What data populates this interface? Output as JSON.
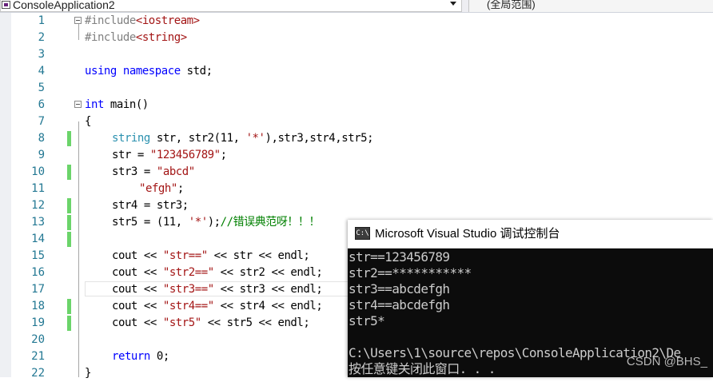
{
  "toolbar": {
    "project_name": "ConsoleApplication2",
    "scope_label": "(全局范围)"
  },
  "editor": {
    "line_numbers": [
      "1",
      "2",
      "3",
      "4",
      "5",
      "6",
      "7",
      "8",
      "9",
      "10",
      "11",
      "12",
      "13",
      "14",
      "15",
      "16",
      "17",
      "18",
      "19",
      "20",
      "21",
      "22"
    ],
    "code": {
      "l1_pp": "#include",
      "l1_hdr": "<iostream>",
      "l2_pp": "#include",
      "l2_hdr": "<string>",
      "l4_kw1": "using",
      "l4_kw2": "namespace",
      "l4_rest": " std;",
      "l6_kw": "int",
      "l6_rest": " main()",
      "l7": "{",
      "l8_ty": "string",
      "l8_a": " str, str2(11, ",
      "l8_s": "'*'",
      "l8_b": "),str3,str4,str5;",
      "l9_a": "str = ",
      "l9_s": "\"123456789\"",
      "l9_b": ";",
      "l10_a": "str3 = ",
      "l10_s": "\"abcd\"",
      "l11_s": "\"efgh\"",
      "l11_b": ";",
      "l12": "str4 = str3;",
      "l13_a": "str5 = (11, ",
      "l13_s": "'*'",
      "l13_b": ");",
      "l13_c": "//错误典范呀！！！",
      "l15_a": "cout << ",
      "l15_s": "\"str==\"",
      "l15_b": " << str << endl;",
      "l16_a": "cout << ",
      "l16_s": "\"str2==\"",
      "l16_b": " << str2 << endl;",
      "l17_a": "cout << ",
      "l17_s": "\"str3==\"",
      "l17_b": " << str3 << endl;",
      "l18_a": "cout << ",
      "l18_s": "\"str4==\"",
      "l18_b": " << str4 << endl;",
      "l19_a": "cout << ",
      "l19_s": "\"str5\"",
      "l19_b": " << str5 << endl;",
      "l21_kw": "return",
      "l21_b": " 0;",
      "l22": "}"
    }
  },
  "console": {
    "icon_label": "C:\\",
    "title": "Microsoft Visual Studio 调试控制台",
    "lines": [
      "str==123456789",
      "str2==***********",
      "str3==abcdefgh",
      "str4==abcdefgh",
      "str5*",
      "",
      "C:\\Users\\1\\source\\repos\\ConsoleApplication2\\De",
      "按任意键关闭此窗口. . ."
    ]
  },
  "watermark": "CSDN @BHS_",
  "colors": {
    "keyword": "#0000ff",
    "type": "#2b91af",
    "string": "#a31515",
    "comment": "#008000",
    "line_number": "#237893",
    "change_marker": "#6bd46a",
    "console_bg": "#0c0c0c"
  }
}
